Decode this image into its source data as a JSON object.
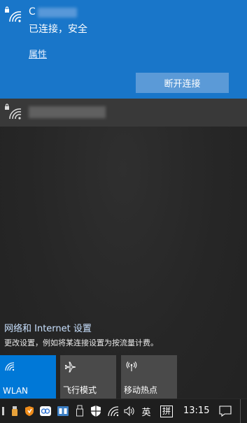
{
  "connected_network": {
    "name_visible": "C",
    "status": "已连接，安全",
    "properties_link": "属性",
    "disconnect_button": "断开连接"
  },
  "settings": {
    "link": "网络和 Internet 设置",
    "description": "更改设置，例如将某连接设置为按流量计费。"
  },
  "quick_actions": [
    {
      "label": "WLAN",
      "icon": "wifi-icon",
      "active": true
    },
    {
      "label": "飞行模式",
      "icon": "airplane-icon",
      "active": false
    },
    {
      "label": "移动热点",
      "icon": "hotspot-icon",
      "active": false
    }
  ],
  "taskbar": {
    "language": "英",
    "ime": "拼",
    "time": "13:15"
  },
  "colors": {
    "accent": "#0078d7",
    "connected_bg": "#1976c9",
    "button_bg": "#5b9ad7",
    "taskbar_bg": "#1e1e1e"
  }
}
